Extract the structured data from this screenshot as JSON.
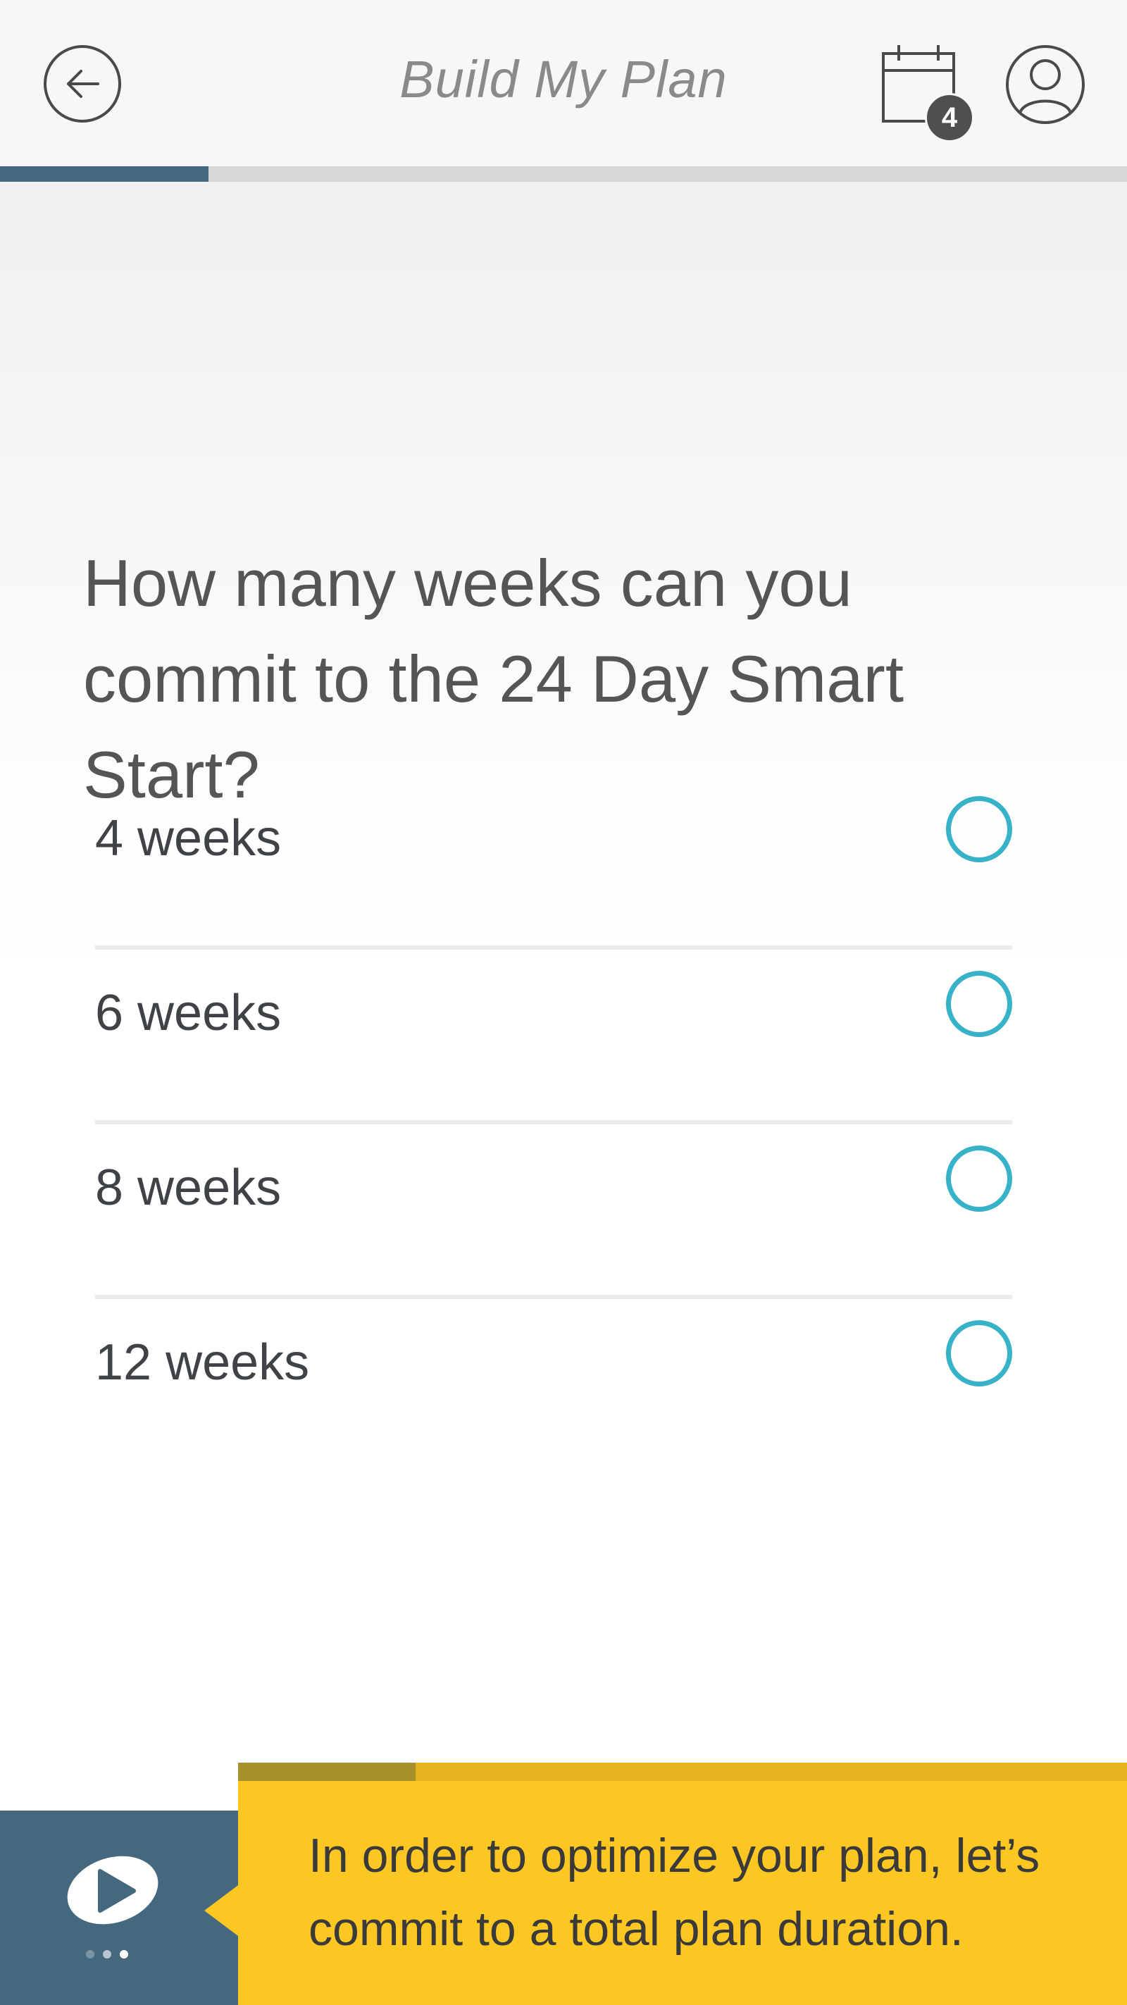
{
  "header": {
    "title": "Build My Plan",
    "back_icon": "arrow-left-icon",
    "calendar_icon": "calendar-icon",
    "calendar_badge": "4",
    "profile_icon": "user-icon"
  },
  "progress": {
    "value": 0.185,
    "color": "#44687e"
  },
  "question": {
    "text": "How many weeks can you commit to the 24 Day Smart Start?"
  },
  "options": [
    {
      "label": "4 weeks",
      "selected": false
    },
    {
      "label": "6 weeks",
      "selected": false
    },
    {
      "label": "8 weeks",
      "selected": false
    },
    {
      "label": "12 weeks",
      "selected": false
    }
  ],
  "assistant": {
    "message": "In order to optimize your plan, let’s commit to a total plan duration.",
    "logo_icon": "play-logo-icon",
    "message_progress": 0.2
  },
  "colors": {
    "accent": "#38b2c9",
    "brand_dark": "#44687e",
    "bubble": "#fcc623"
  }
}
